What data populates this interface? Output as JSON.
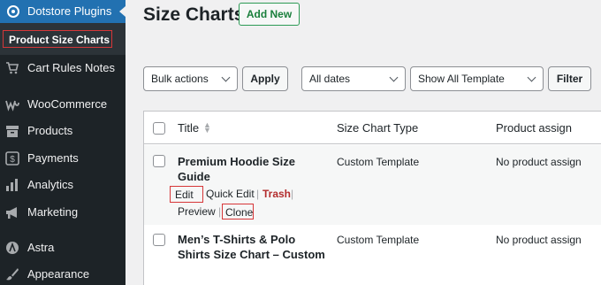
{
  "sidebar": {
    "header": {
      "label": "Dotstore Plugins",
      "icon": "dotstore-icon"
    },
    "submenu_active": "Product Size Charts",
    "items": [
      {
        "label": "Cart Rules Notes",
        "icon": "cart-icon"
      },
      {
        "label": "WooCommerce",
        "icon": "woocommerce-icon"
      },
      {
        "label": "Products",
        "icon": "archive-icon"
      },
      {
        "label": "Payments",
        "icon": "dollar-icon"
      },
      {
        "label": "Analytics",
        "icon": "bar-chart-icon"
      },
      {
        "label": "Marketing",
        "icon": "megaphone-icon"
      },
      {
        "label": "Astra",
        "icon": "astra-icon"
      },
      {
        "label": "Appearance",
        "icon": "brush-icon"
      }
    ],
    "accent_color": "#2271b1"
  },
  "page": {
    "title": "Size Charts",
    "add_new_label": "Add New"
  },
  "filters": {
    "bulk_actions": "Bulk actions",
    "apply_label": "Apply",
    "dates": "All dates",
    "template": "Show All Template",
    "filter_label": "Filter"
  },
  "table": {
    "columns": [
      "Title",
      "Size Chart Type",
      "Product assign"
    ],
    "rows": [
      {
        "title_line1": "Premium Hoodie Size",
        "title_line2": "Guide",
        "type": "Custom Template",
        "assign": "No product assign",
        "actions": {
          "edit": "Edit",
          "quick_edit": "Quick Edit",
          "trash": "Trash",
          "preview": "Preview",
          "clone": "Clone",
          "separator": "|"
        }
      },
      {
        "title_line1": "Men’s T-Shirts & Polo",
        "title_line2": "Shirts Size Chart – Custom",
        "type": "Custom Template",
        "assign": "No product assign"
      }
    ]
  }
}
